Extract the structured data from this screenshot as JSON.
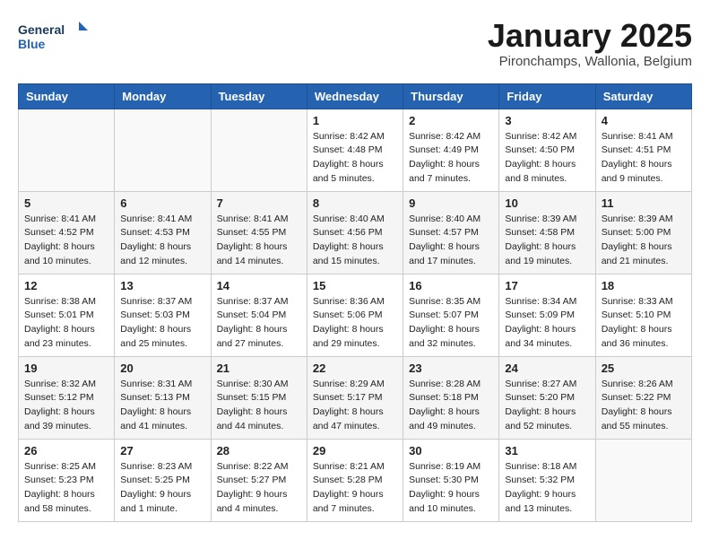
{
  "logo": {
    "line1": "General",
    "line2": "Blue"
  },
  "title": "January 2025",
  "subtitle": "Pironchamps, Wallonia, Belgium",
  "weekdays": [
    "Sunday",
    "Monday",
    "Tuesday",
    "Wednesday",
    "Thursday",
    "Friday",
    "Saturday"
  ],
  "weeks": [
    [
      {
        "day": "",
        "info": ""
      },
      {
        "day": "",
        "info": ""
      },
      {
        "day": "",
        "info": ""
      },
      {
        "day": "1",
        "info": "Sunrise: 8:42 AM\nSunset: 4:48 PM\nDaylight: 8 hours\nand 5 minutes."
      },
      {
        "day": "2",
        "info": "Sunrise: 8:42 AM\nSunset: 4:49 PM\nDaylight: 8 hours\nand 7 minutes."
      },
      {
        "day": "3",
        "info": "Sunrise: 8:42 AM\nSunset: 4:50 PM\nDaylight: 8 hours\nand 8 minutes."
      },
      {
        "day": "4",
        "info": "Sunrise: 8:41 AM\nSunset: 4:51 PM\nDaylight: 8 hours\nand 9 minutes."
      }
    ],
    [
      {
        "day": "5",
        "info": "Sunrise: 8:41 AM\nSunset: 4:52 PM\nDaylight: 8 hours\nand 10 minutes."
      },
      {
        "day": "6",
        "info": "Sunrise: 8:41 AM\nSunset: 4:53 PM\nDaylight: 8 hours\nand 12 minutes."
      },
      {
        "day": "7",
        "info": "Sunrise: 8:41 AM\nSunset: 4:55 PM\nDaylight: 8 hours\nand 14 minutes."
      },
      {
        "day": "8",
        "info": "Sunrise: 8:40 AM\nSunset: 4:56 PM\nDaylight: 8 hours\nand 15 minutes."
      },
      {
        "day": "9",
        "info": "Sunrise: 8:40 AM\nSunset: 4:57 PM\nDaylight: 8 hours\nand 17 minutes."
      },
      {
        "day": "10",
        "info": "Sunrise: 8:39 AM\nSunset: 4:58 PM\nDaylight: 8 hours\nand 19 minutes."
      },
      {
        "day": "11",
        "info": "Sunrise: 8:39 AM\nSunset: 5:00 PM\nDaylight: 8 hours\nand 21 minutes."
      }
    ],
    [
      {
        "day": "12",
        "info": "Sunrise: 8:38 AM\nSunset: 5:01 PM\nDaylight: 8 hours\nand 23 minutes."
      },
      {
        "day": "13",
        "info": "Sunrise: 8:37 AM\nSunset: 5:03 PM\nDaylight: 8 hours\nand 25 minutes."
      },
      {
        "day": "14",
        "info": "Sunrise: 8:37 AM\nSunset: 5:04 PM\nDaylight: 8 hours\nand 27 minutes."
      },
      {
        "day": "15",
        "info": "Sunrise: 8:36 AM\nSunset: 5:06 PM\nDaylight: 8 hours\nand 29 minutes."
      },
      {
        "day": "16",
        "info": "Sunrise: 8:35 AM\nSunset: 5:07 PM\nDaylight: 8 hours\nand 32 minutes."
      },
      {
        "day": "17",
        "info": "Sunrise: 8:34 AM\nSunset: 5:09 PM\nDaylight: 8 hours\nand 34 minutes."
      },
      {
        "day": "18",
        "info": "Sunrise: 8:33 AM\nSunset: 5:10 PM\nDaylight: 8 hours\nand 36 minutes."
      }
    ],
    [
      {
        "day": "19",
        "info": "Sunrise: 8:32 AM\nSunset: 5:12 PM\nDaylight: 8 hours\nand 39 minutes."
      },
      {
        "day": "20",
        "info": "Sunrise: 8:31 AM\nSunset: 5:13 PM\nDaylight: 8 hours\nand 41 minutes."
      },
      {
        "day": "21",
        "info": "Sunrise: 8:30 AM\nSunset: 5:15 PM\nDaylight: 8 hours\nand 44 minutes."
      },
      {
        "day": "22",
        "info": "Sunrise: 8:29 AM\nSunset: 5:17 PM\nDaylight: 8 hours\nand 47 minutes."
      },
      {
        "day": "23",
        "info": "Sunrise: 8:28 AM\nSunset: 5:18 PM\nDaylight: 8 hours\nand 49 minutes."
      },
      {
        "day": "24",
        "info": "Sunrise: 8:27 AM\nSunset: 5:20 PM\nDaylight: 8 hours\nand 52 minutes."
      },
      {
        "day": "25",
        "info": "Sunrise: 8:26 AM\nSunset: 5:22 PM\nDaylight: 8 hours\nand 55 minutes."
      }
    ],
    [
      {
        "day": "26",
        "info": "Sunrise: 8:25 AM\nSunset: 5:23 PM\nDaylight: 8 hours\nand 58 minutes."
      },
      {
        "day": "27",
        "info": "Sunrise: 8:23 AM\nSunset: 5:25 PM\nDaylight: 9 hours\nand 1 minute."
      },
      {
        "day": "28",
        "info": "Sunrise: 8:22 AM\nSunset: 5:27 PM\nDaylight: 9 hours\nand 4 minutes."
      },
      {
        "day": "29",
        "info": "Sunrise: 8:21 AM\nSunset: 5:28 PM\nDaylight: 9 hours\nand 7 minutes."
      },
      {
        "day": "30",
        "info": "Sunrise: 8:19 AM\nSunset: 5:30 PM\nDaylight: 9 hours\nand 10 minutes."
      },
      {
        "day": "31",
        "info": "Sunrise: 8:18 AM\nSunset: 5:32 PM\nDaylight: 9 hours\nand 13 minutes."
      },
      {
        "day": "",
        "info": ""
      }
    ]
  ]
}
